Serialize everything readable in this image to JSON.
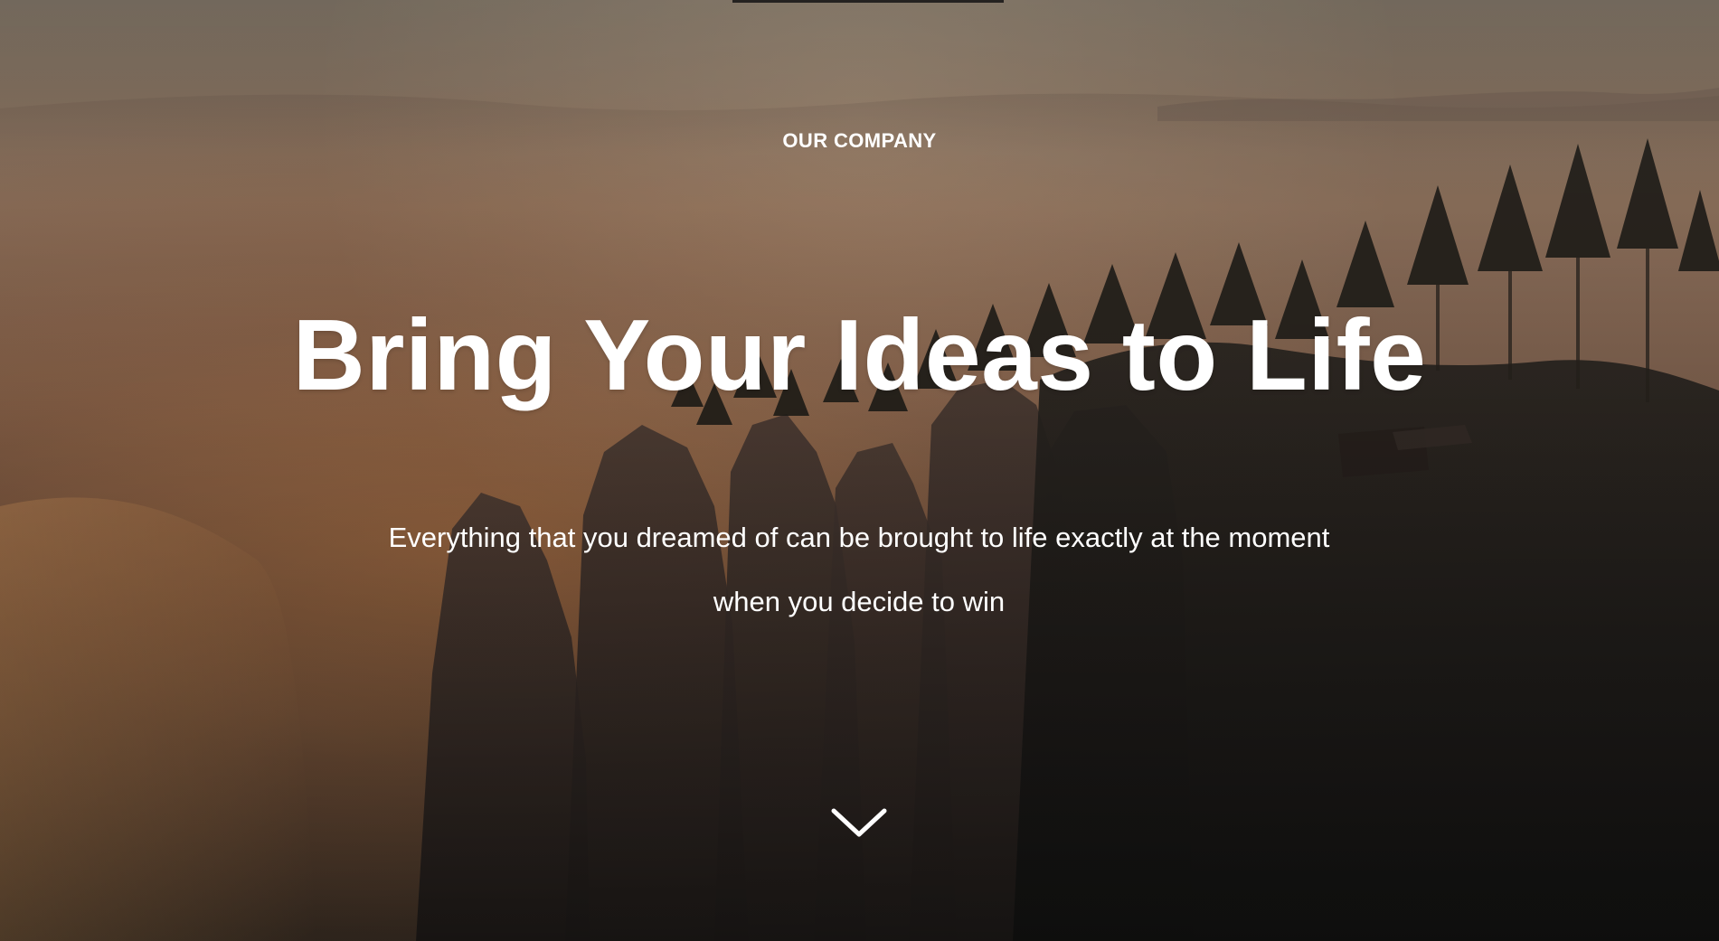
{
  "hero": {
    "eyebrow": "OUR COMPANY",
    "title": "Bring Your Ideas to Life",
    "subtitle": "Everything that you dreamed of can be brought to life exactly at the moment when you decide to win",
    "scroll_icon": "chevron-down-icon",
    "colors": {
      "text": "#ffffff",
      "background_top": "#7f7466",
      "background_mid": "#9a7b64",
      "background_bottom": "#2a2521"
    }
  }
}
